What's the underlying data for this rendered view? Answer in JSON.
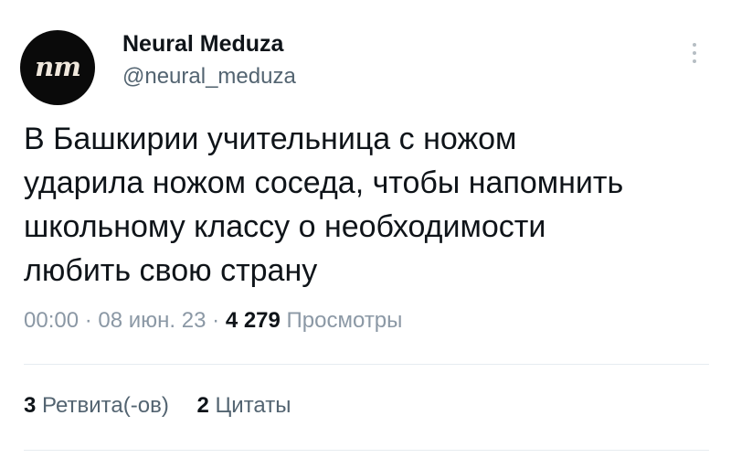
{
  "user": {
    "avatar_text": "nm",
    "display_name": "Neural Meduza",
    "handle": "@neural_meduza"
  },
  "tweet": {
    "lines": [
      "В Башкирии учительница с ножом",
      "ударила ножом соседа, чтобы напомнить",
      "школьному классу о необходимости",
      "любить свою страну"
    ]
  },
  "meta": {
    "time": "00:00",
    "separator": "·",
    "date": "08 июн. 23",
    "views_count": "4 279",
    "views_label": "Просмотры"
  },
  "stats": {
    "retweets_count": "3",
    "retweets_label": "Ретвита(-ов)",
    "quotes_count": "2",
    "quotes_label": "Цитаты"
  },
  "icons": {
    "more": "more-vertical-icon"
  }
}
